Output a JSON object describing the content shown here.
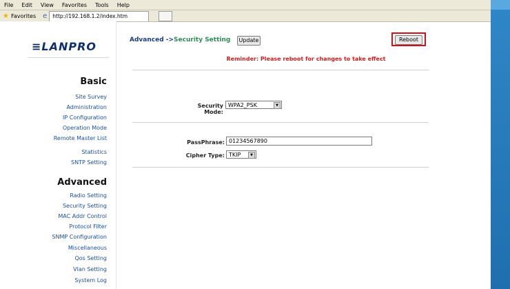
{
  "browser": {
    "menu": [
      "File",
      "Edit",
      "View",
      "Favorites",
      "Tools",
      "Help"
    ],
    "favorites_label": "Favorites",
    "tab_url": "http://192.168.1.2/index.htm"
  },
  "sidebar": {
    "logo_text": "LANPRO",
    "basic": {
      "title": "Basic",
      "items": [
        "Site Survey",
        "Administration",
        "IP Configuration",
        "Operation Mode",
        "Remote Master List",
        "Statistics",
        "SNTP Setting"
      ]
    },
    "advanced": {
      "title": "Advanced",
      "items": [
        "Radio Setting",
        "Security Setting",
        "MAC Addr Control",
        "Protocol Filter",
        "SNMP Configuration",
        "Miscellaneous",
        "Qos Setting",
        "Vlan Setting",
        "System Log"
      ]
    }
  },
  "main": {
    "breadcrumb_prefix": "Advanced ->",
    "breadcrumb_current": "Security Setting",
    "update_label": "Update",
    "reboot_label": "Reboot",
    "reminder": "Reminder: Please reboot for changes to take effect",
    "security_mode_label": "Security Mode:",
    "security_mode_value": "WPA2_PSK",
    "passphrase_label": "PassPhrase:",
    "passphrase_value": "01234567890",
    "cipher_type_label": "Cipher Type:",
    "cipher_type_value": "TKIP"
  },
  "colors": {
    "frame": "#2f86c6",
    "nav_link": "#1a4fa3",
    "reminder": "#d11f1f",
    "reboot_highlight": "#d20f17"
  }
}
